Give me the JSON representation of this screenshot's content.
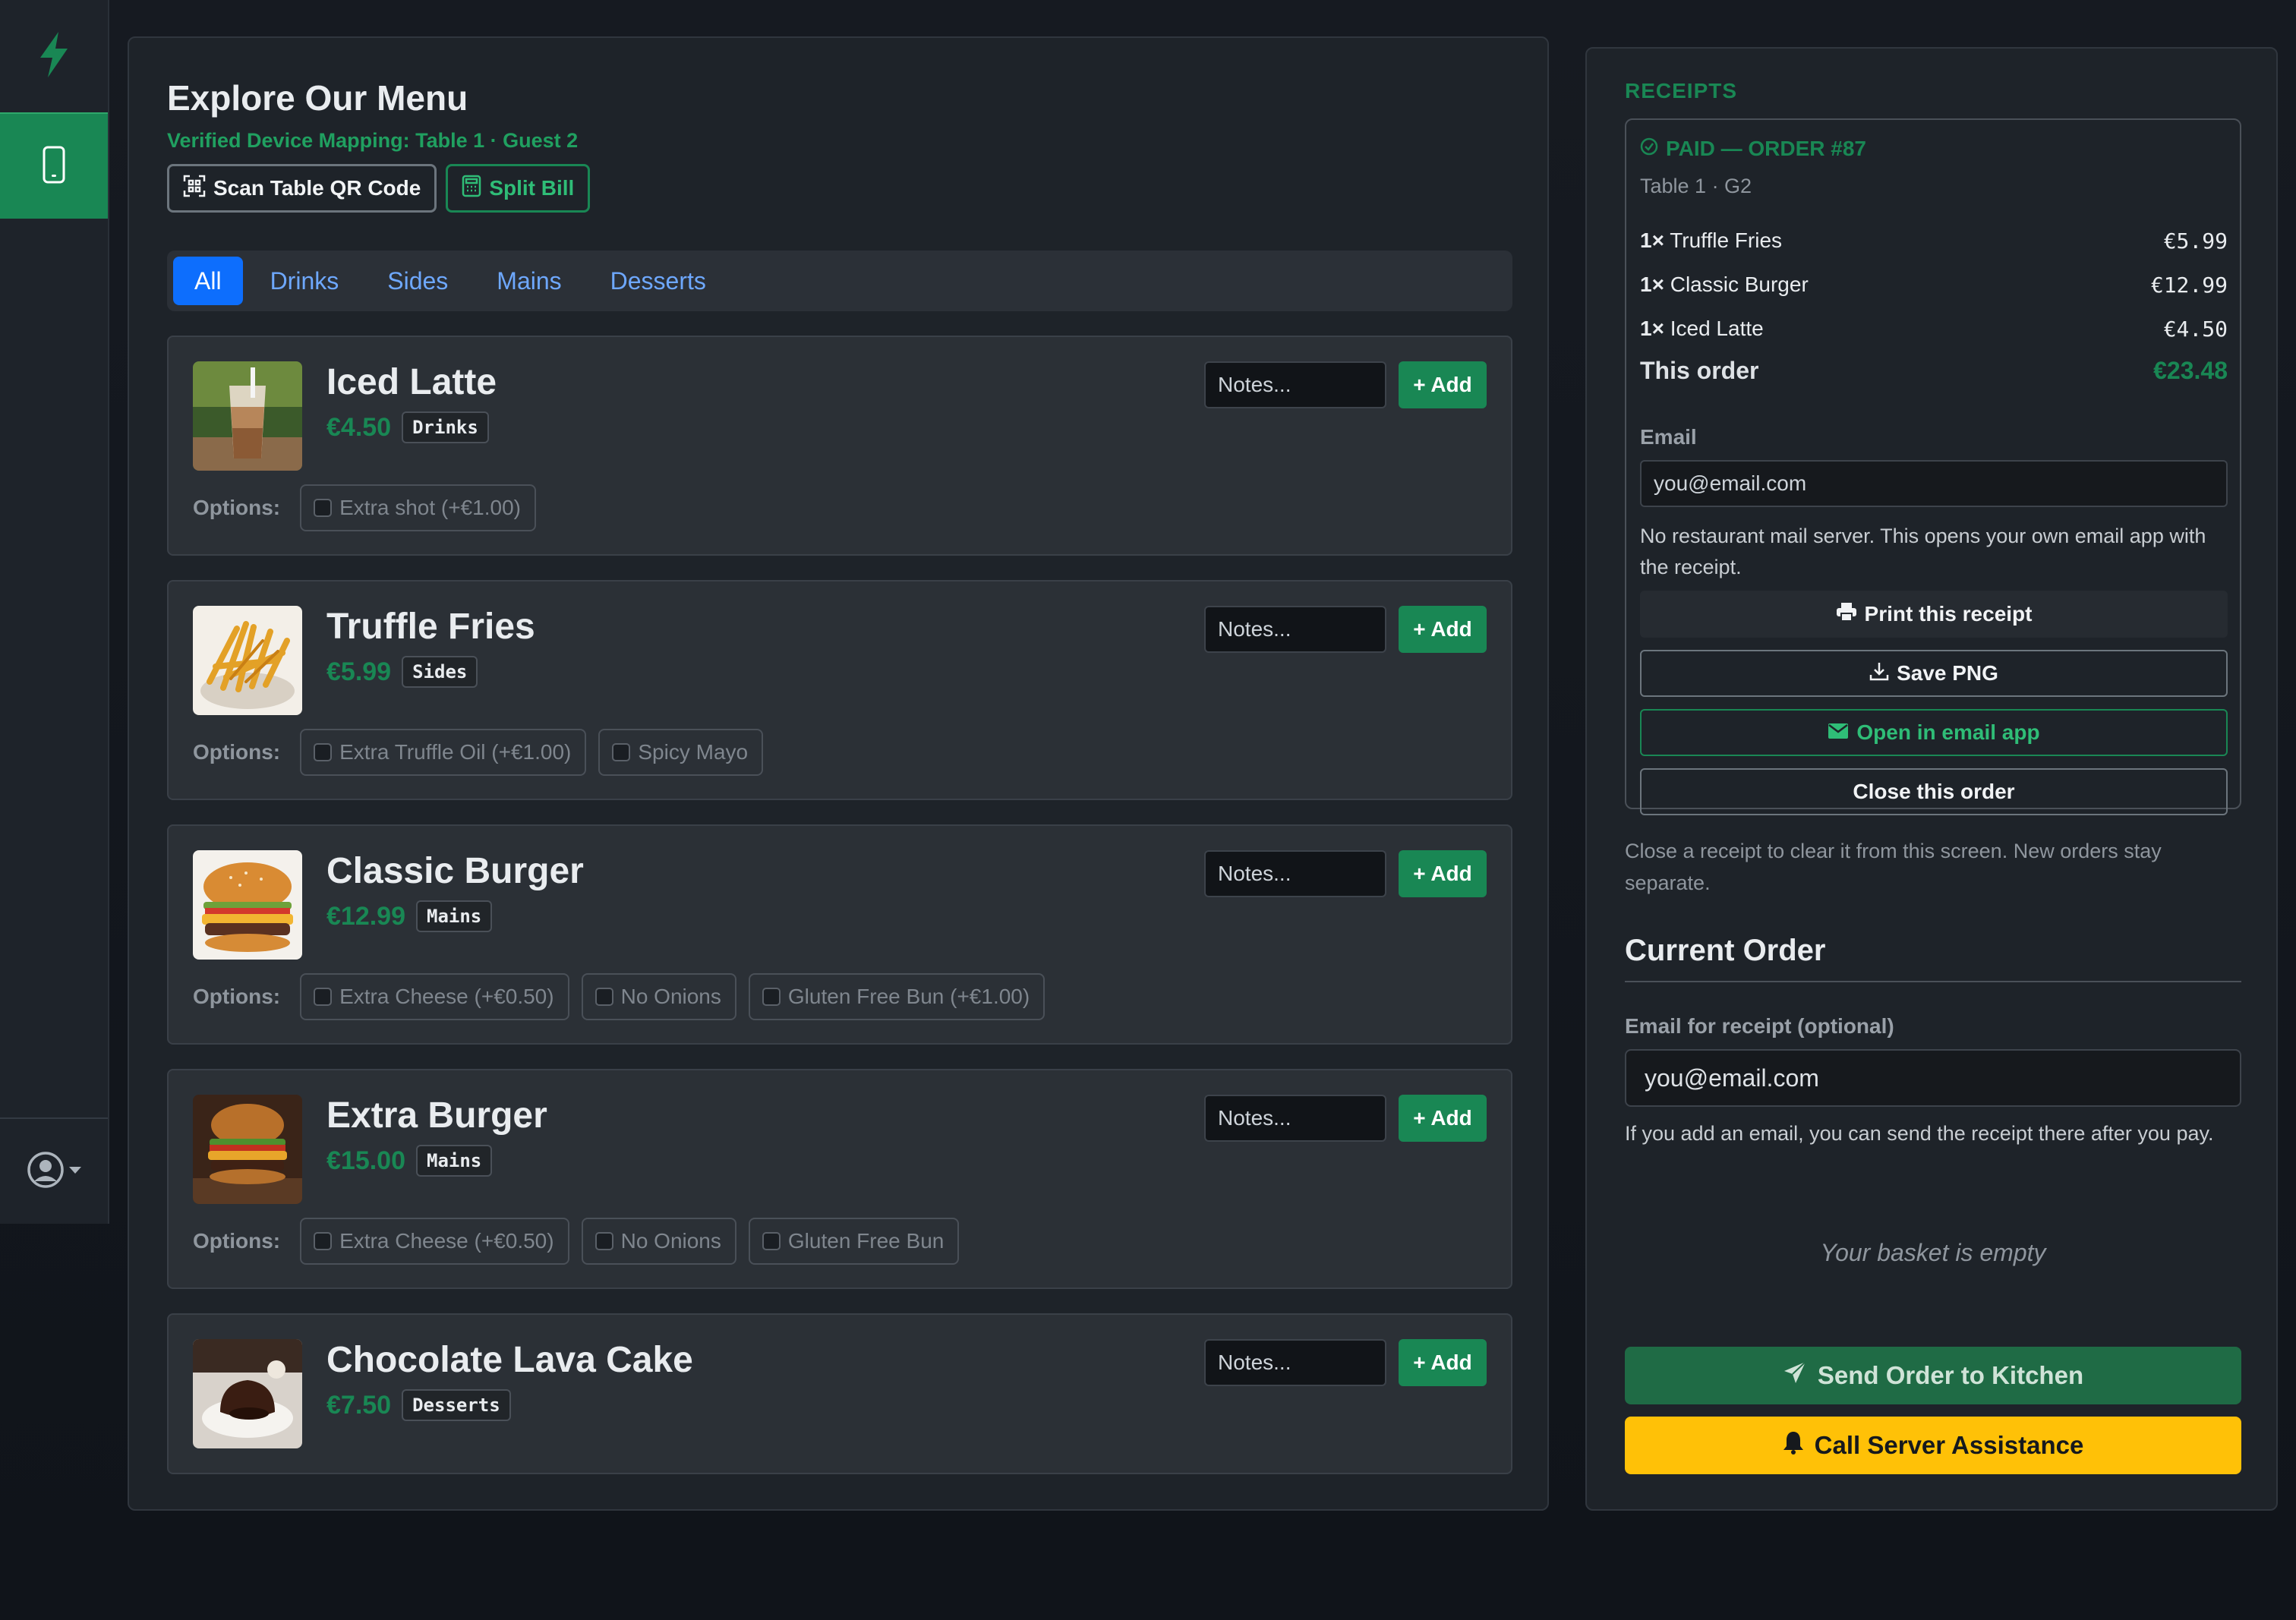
{
  "rail": {
    "logo_icon": "lightning-bolt-icon",
    "active_nav_icon": "phone-icon",
    "user_icon": "user-circle-icon"
  },
  "menu": {
    "title": "Explore Our Menu",
    "mapping": "Verified Device Mapping: Table 1 · Guest 2",
    "scan_label": "Scan Table QR Code",
    "split_label": "Split Bill",
    "tabs": [
      {
        "label": "All",
        "active": true
      },
      {
        "label": "Drinks"
      },
      {
        "label": "Sides"
      },
      {
        "label": "Mains"
      },
      {
        "label": "Desserts"
      }
    ],
    "notes_placeholder": "Notes...",
    "add_label": "+ Add",
    "options_label": "Options:",
    "items": [
      {
        "name": "Iced Latte",
        "price": "€4.50",
        "category": "Drinks",
        "options": [
          "Extra shot (+€1.00)"
        ]
      },
      {
        "name": "Truffle Fries",
        "price": "€5.99",
        "category": "Sides",
        "options": [
          "Extra Truffle Oil (+€1.00)",
          "Spicy Mayo"
        ]
      },
      {
        "name": "Classic Burger",
        "price": "€12.99",
        "category": "Mains",
        "options": [
          "Extra Cheese (+€0.50)",
          "No Onions",
          "Gluten Free Bun (+€1.00)"
        ]
      },
      {
        "name": "Extra Burger",
        "price": "€15.00",
        "category": "Mains",
        "options": [
          "Extra Cheese (+€0.50)",
          "No Onions",
          "Gluten Free Bun"
        ]
      },
      {
        "name": "Chocolate Lava Cake",
        "price": "€7.50",
        "category": "Desserts",
        "options": []
      }
    ]
  },
  "receipts": {
    "header": "RECEIPTS",
    "status": "PAID — ORDER #87",
    "table": "Table 1 · G2",
    "lines": [
      {
        "qty": "1×",
        "name": "Truffle Fries",
        "amount": "€5.99"
      },
      {
        "qty": "1×",
        "name": "Classic Burger",
        "amount": "€12.99"
      },
      {
        "qty": "1×",
        "name": "Iced Latte",
        "amount": "€4.50"
      }
    ],
    "total_label": "This order",
    "total_value": "€23.48",
    "email_label": "Email",
    "email_placeholder": "you@email.com",
    "mail_note": "No restaurant mail server. This opens your own email app with the receipt.",
    "print_label": "Print this receipt",
    "save_label": "Save PNG",
    "mail_label": "Open in email app",
    "close_label": "Close this order",
    "clear_note": "Close a receipt to clear it from this screen. New orders stay separate."
  },
  "current": {
    "title": "Current Order",
    "email_label": "Email for receipt (optional)",
    "email_placeholder": "you@email.com",
    "help": "If you add an email, you can send the receipt there after you pay.",
    "empty": "Your basket is empty",
    "send_label": "Send Order to Kitchen",
    "call_label": "Call Server Assistance"
  },
  "colors": {
    "accent_green": "#198754",
    "tab_blue": "#0d6efd",
    "assist_yellow": "#ffc107"
  }
}
